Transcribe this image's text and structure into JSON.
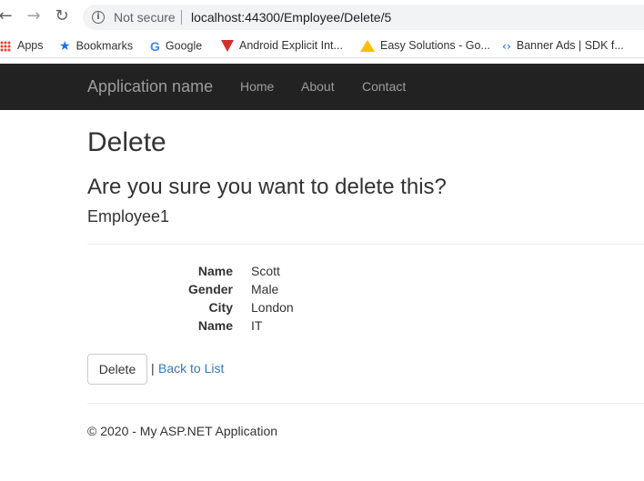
{
  "browser": {
    "security_label": "Not secure",
    "url": "localhost:44300/Employee/Delete/5",
    "bookmarks": [
      {
        "label": "Apps",
        "icon": "apps-grid-icon"
      },
      {
        "label": "Bookmarks",
        "icon": "star-icon"
      },
      {
        "label": "Google",
        "icon": "google-icon"
      },
      {
        "label": "Android Explicit Int...",
        "icon": "red-triangle-icon"
      },
      {
        "label": "Easy Solutions - Go...",
        "icon": "google-drive-icon"
      },
      {
        "label": "Banner Ads  |  SDK f...",
        "icon": "code-brackets-icon"
      }
    ]
  },
  "navbar": {
    "brand": "Application name",
    "links": [
      "Home",
      "About",
      "Contact"
    ],
    "background": "#222222"
  },
  "page": {
    "title": "Delete",
    "question": "Are you sure you want to delete this?",
    "subtitle": "Employee1",
    "fields": [
      {
        "label": "Name",
        "value": "Scott"
      },
      {
        "label": "Gender",
        "value": "Male"
      },
      {
        "label": "City",
        "value": "London"
      },
      {
        "label": "Name",
        "value": "IT"
      }
    ],
    "delete_button": "Delete",
    "separator": "|",
    "back_link": "Back to List",
    "link_color": "#337ab7"
  },
  "footer": {
    "text": "© 2020 - My ASP.NET Application"
  }
}
